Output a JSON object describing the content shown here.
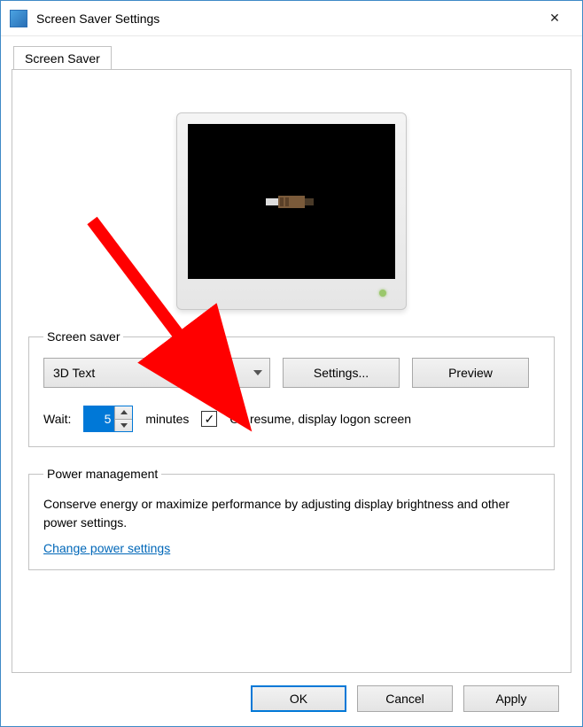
{
  "window": {
    "title": "Screen Saver Settings",
    "close_icon": "✕"
  },
  "tab": {
    "label": "Screen Saver"
  },
  "screenSaverGroup": {
    "legend": "Screen saver",
    "selected": "3D Text",
    "settings_btn": "Settings...",
    "preview_btn": "Preview",
    "wait_label": "Wait:",
    "wait_value": "5",
    "minutes_label": "minutes",
    "resume_checked": true,
    "resume_label": "On resume, display logon screen"
  },
  "powerGroup": {
    "legend": "Power management",
    "description": "Conserve energy or maximize performance by adjusting display brightness and other power settings.",
    "link": "Change power settings"
  },
  "buttons": {
    "ok": "OK",
    "cancel": "Cancel",
    "apply": "Apply"
  },
  "annotation": {
    "arrow_color": "#ff0000"
  }
}
